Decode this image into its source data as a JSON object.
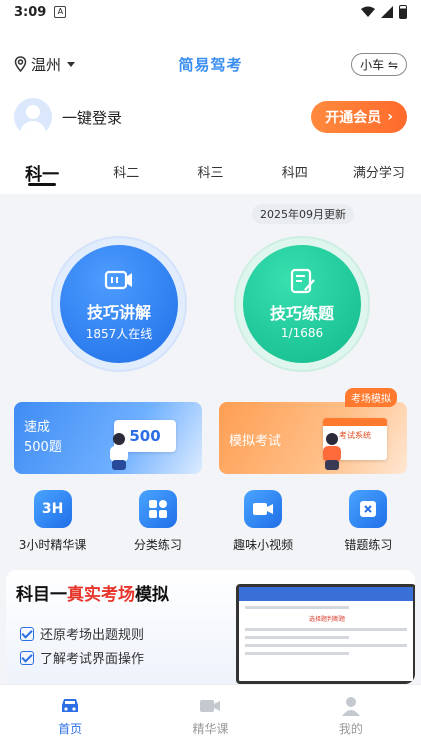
{
  "status_bar": {
    "time": "3:09",
    "notif_glyph": "A"
  },
  "header": {
    "location": "温州",
    "app_title": "简易驾考",
    "car_switch": "小车 ⇋"
  },
  "login": {
    "text": "一键登录",
    "vip_button": "开通会员",
    "vip_arrow": "›"
  },
  "tabs": [
    {
      "label": "科一"
    },
    {
      "label": "科二"
    },
    {
      "label": "科三"
    },
    {
      "label": "科四"
    },
    {
      "label": "满分学习"
    }
  ],
  "update_badge": "2025年09月更新",
  "circles": {
    "skills": {
      "title": "技巧讲解",
      "sub": "1857人在线"
    },
    "practice": {
      "title": "技巧练题",
      "sub": "1/1686"
    }
  },
  "banners": {
    "quick": {
      "line1": "速成",
      "line2": "500题",
      "board": "500"
    },
    "mock": {
      "label": "模拟考试",
      "tag": "考场模拟",
      "monitor": "考试系统"
    }
  },
  "quick_actions": [
    {
      "label": "3小时精华课",
      "icon_text": "3H"
    },
    {
      "label": "分类练习",
      "icon_text": ""
    },
    {
      "label": "趣味小视频",
      "icon_text": ""
    },
    {
      "label": "错题练习",
      "icon_text": ""
    }
  ],
  "promo": {
    "title_pre": "科目一",
    "title_highlight": "真实考场",
    "title_post": "模拟",
    "lines": [
      "还原考场出题规则",
      "了解考试界面操作"
    ],
    "screen_hint": "选择题判断题"
  },
  "bottom_nav": [
    {
      "label": "首页"
    },
    {
      "label": "精华课"
    },
    {
      "label": "我的"
    }
  ],
  "colors": {
    "accent": "#2b6ee5",
    "title_blue": "#3a8ef0",
    "vip_orange": "#ff6a2b",
    "green": "#12b98c"
  }
}
